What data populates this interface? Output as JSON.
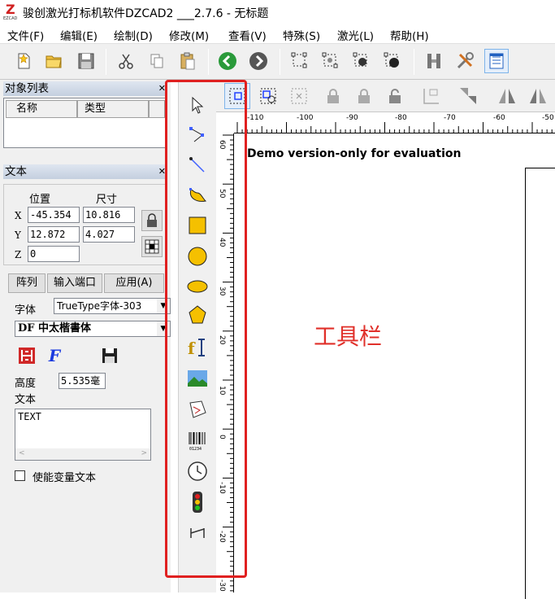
{
  "window": {
    "title": "骏创激光打标机软件DZCAD2 ___2.7.6 - 无标题"
  },
  "menu": [
    "文件(F)",
    "编辑(E)",
    "绘制(D)",
    "修改(M)",
    "查看(V)",
    "特殊(S)",
    "激光(L)",
    "帮助(H)"
  ],
  "object_list": {
    "title": "对象列表",
    "col_name": "名称",
    "col_type": "类型"
  },
  "text_panel": {
    "title": "文本",
    "position_label": "位置",
    "size_label": "尺寸",
    "x_label": "X",
    "y_label": "Y",
    "z_label": "Z",
    "x_pos": "-45.354",
    "x_size": "10.816",
    "y_pos": "12.872",
    "y_size": "4.027",
    "z_pos": "0",
    "array_button": "阵列",
    "input_port_button": "输入端口",
    "apply_button": "应用(A)",
    "font_label": "字体",
    "font_type": "TrueType字体-303",
    "font_name": "DF 中太楷書体",
    "height_label": "高度",
    "height_value": "5.535毫",
    "text_label": "文本",
    "text_value": "TEXT",
    "variable_text_label": "使能变量文本"
  },
  "canvas": {
    "watermark": "Demo version-only for evaluation",
    "hruler_ticks": [
      "-110",
      "-100",
      "-90",
      "-80",
      "-70",
      "-60",
      "-50"
    ],
    "vruler_ticks": [
      "60",
      "50",
      "40",
      "30",
      "20",
      "10",
      "0",
      "-10",
      "-20",
      "-30"
    ]
  },
  "annotation": "工具栏",
  "colors": {
    "annotation": "#e0302a",
    "highlight_box": "#e02020"
  }
}
